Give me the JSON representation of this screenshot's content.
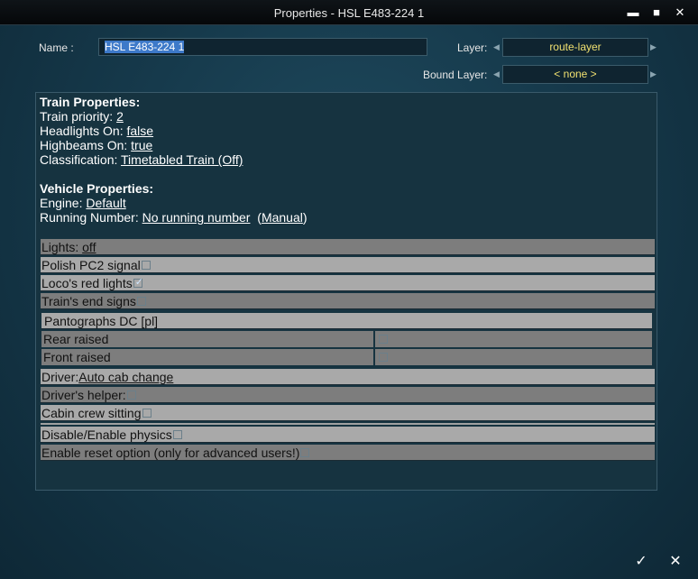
{
  "window": {
    "title": "Properties - HSL E483-224 1",
    "minimize_glyph": "▬",
    "maximize_glyph": "■",
    "close_glyph": "✕"
  },
  "form": {
    "name_label": "Name :",
    "name_value": "HSL E483-224 1",
    "layer_label": "Layer:",
    "layer_value": "route-layer",
    "bound_layer_label": "Bound Layer:",
    "bound_layer_value": "< none >"
  },
  "train_properties": {
    "header": "Train Properties:",
    "priority_label": "Train priority: ",
    "priority_value": "2",
    "headlights_label": "Headlights On: ",
    "headlights_value": "false",
    "highbeams_label": "Highbeams On: ",
    "highbeams_value": "true",
    "classification_label": "Classification: ",
    "classification_value": "Timetabled Train (Off)"
  },
  "vehicle_properties": {
    "header": "Vehicle Properties:",
    "engine_label": "Engine: ",
    "engine_value": "Default",
    "running_number_label": "Running Number: ",
    "running_number_value": "No running number",
    "manual_label": "Manual"
  },
  "options": {
    "lights_label": "Lights: ",
    "lights_value": "off",
    "polish_pc2": "Polish PC2 signal",
    "locos_red_lights": "Loco's red lights",
    "trains_end_signs": "Train's end signs",
    "pantographs_header": "Pantographs DC [pl]",
    "rear_raised": "Rear raised",
    "front_raised": "Front raised",
    "driver_label": "Driver:",
    "driver_value": "Auto cab change",
    "drivers_helper": "Driver's helper:",
    "cabin_crew_sitting": "Cabin crew sitting",
    "disable_enable_physics": "Disable/Enable physics",
    "enable_reset": "Enable reset option (only for advanced users!)"
  },
  "buttons": {
    "ok_glyph": "✓",
    "cancel_glyph": "✕"
  },
  "colors": {
    "layer_text": "#f0e070",
    "selection": "#3d79c9"
  }
}
